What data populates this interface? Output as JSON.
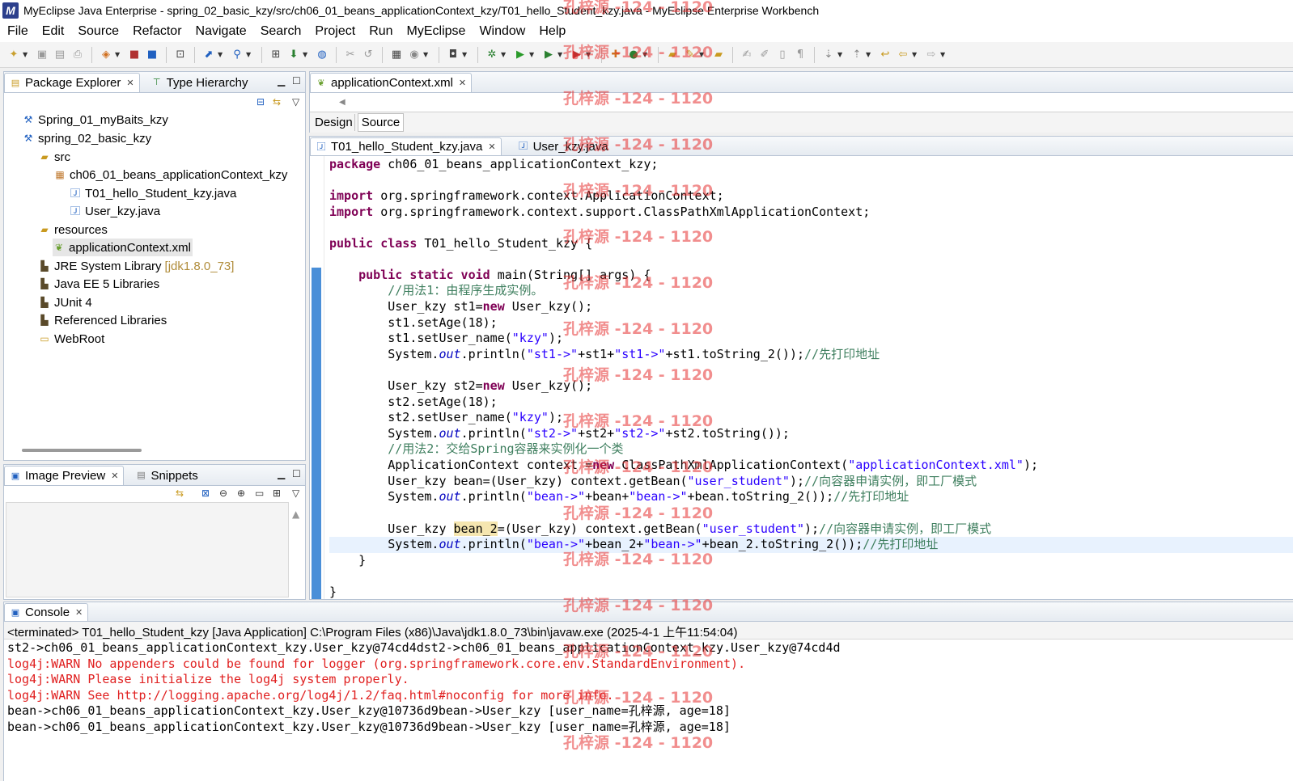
{
  "window": {
    "title": "MyEclipse Java Enterprise - spring_02_basic_kzy/src/ch06_01_beans_applicationContext_kzy/T01_hello_Student_kzy.java - MyEclipse Enterprise Workbench"
  },
  "menu": [
    "File",
    "Edit",
    "Source",
    "Refactor",
    "Navigate",
    "Search",
    "Project",
    "Run",
    "MyEclipse",
    "Window",
    "Help"
  ],
  "package_explorer": {
    "tabs": [
      "Package Explorer",
      "Type Hierarchy"
    ],
    "tree": [
      {
        "label": "Spring_01_myBaits_kzy",
        "icon": "project-icon"
      },
      {
        "label": "spring_02_basic_kzy",
        "icon": "project-icon"
      },
      {
        "label": "src",
        "icon": "source-folder-icon"
      },
      {
        "label": "ch06_01_beans_applicationContext_kzy",
        "icon": "package-icon"
      },
      {
        "label": "T01_hello_Student_kzy.java",
        "icon": "java-file-icon"
      },
      {
        "label": "User_kzy.java",
        "icon": "java-file-icon"
      },
      {
        "label": "resources",
        "icon": "source-folder-icon"
      },
      {
        "label": "applicationContext.xml",
        "icon": "xml-file-icon"
      },
      {
        "label": "JRE System Library",
        "decoration": "[jdk1.8.0_73]",
        "icon": "library-icon"
      },
      {
        "label": "Java EE 5 Libraries",
        "icon": "library-icon"
      },
      {
        "label": "JUnit 4",
        "icon": "library-icon"
      },
      {
        "label": "Referenced Libraries",
        "icon": "library-icon"
      },
      {
        "label": "WebRoot",
        "icon": "folder-icon"
      }
    ]
  },
  "image_preview": {
    "tabs": [
      "Image Preview",
      "Snippets"
    ]
  },
  "xml_editor": {
    "tab": "applicationContext.xml",
    "subtabs": [
      "Design",
      "Source"
    ]
  },
  "java_editor": {
    "tabs": [
      "T01_hello_Student_kzy.java",
      "User_kzy.java"
    ],
    "code": {
      "l1a": "package",
      "l1b": " ch06_01_beans_applicationContext_kzy;",
      "l3a": "import",
      "l3b": " org.springframework.context.ApplicationContext;",
      "l4a": "import",
      "l4b": " org.springframework.context.support.ClassPathXmlApplicationContext;",
      "l6a": "public class",
      "l6b": " T01_hello_Student_kzy {",
      "l8pre": "    ",
      "l8a": "public static void",
      "l8b": " main(String[] args) {",
      "l9": "        //用法1：由程序生成实例。",
      "l10a": "        User_kzy st1=",
      "l10b": "new",
      "l10c": " User_kzy();",
      "l11": "        st1.setAge(18);",
      "l12a": "        st1.setUser_name(",
      "l12b": "\"kzy\"",
      "l12c": ");",
      "l13a": "        System.",
      "l13b": "out",
      "l13c": ".println(",
      "l13d": "\"st1->\"",
      "l13e": "+st1+",
      "l13f": "\"st1->\"",
      "l13g": "+st1.toString_2());",
      "l13h": "//先打印地址",
      "l15a": "        User_kzy st2=",
      "l15b": "new",
      "l15c": " User_kzy();",
      "l16": "        st2.setAge(18);",
      "l17a": "        st2.setUser_name(",
      "l17b": "\"kzy\"",
      "l17c": ");",
      "l18a": "        System.",
      "l18b": "out",
      "l18c": ".println(",
      "l18d": "\"st2->\"",
      "l18e": "+st2+",
      "l18f": "\"st2->\"",
      "l18g": "+st2.toString());",
      "l19": "        //用法2：交给Spring容器来实例化一个类",
      "l20a": "        ApplicationContext context =",
      "l20b": "new",
      "l20c": " ClassPathXmlApplicationContext(",
      "l20d": "\"applicationContext.xml\"",
      "l20e": ");",
      "l21a": "        User_kzy bean=(User_kzy) context.getBean(",
      "l21b": "\"user_student\"",
      "l21c": ");",
      "l21d": "//向容器申请实例，即工厂模式",
      "l22a": "        System.",
      "l22b": "out",
      "l22c": ".println(",
      "l22d": "\"bean->\"",
      "l22e": "+bean+",
      "l22f": "\"bean->\"",
      "l22g": "+bean.toString_2());",
      "l22h": "//先打印地址",
      "l24a": "        User_kzy ",
      "l24b": "bean_2",
      "l24c": "=(User_kzy) context.getBean(",
      "l24d": "\"user_student\"",
      "l24e": ");",
      "l24f": "//向容器申请实例，即工厂模式",
      "l25a": "        System.",
      "l25b": "out",
      "l25c": ".println(",
      "l25d": "\"bean->\"",
      "l25e": "+bean_2+",
      "l25f": "\"bean->\"",
      "l25g": "+bean_2.toString_2());",
      "l25h": "//先打印地址",
      "l26": "    }",
      "l28": "}"
    }
  },
  "console": {
    "tab": "Console",
    "header": "<terminated> T01_hello_Student_kzy [Java Application] C:\\Program Files (x86)\\Java\\jdk1.8.0_73\\bin\\javaw.exe (2025-4-1 上午11:54:04)",
    "lines": [
      "st2->ch06_01_beans_applicationContext_kzy.User_kzy@74cd4dst2->ch06_01_beans_applicationContext_kzy.User_kzy@74cd4d",
      "log4j:WARN No appenders could be found for logger (org.springframework.core.env.StandardEnvironment).",
      "log4j:WARN Please initialize the log4j system properly.",
      "log4j:WARN See http://logging.apache.org/log4j/1.2/faq.html#noconfig for more info.",
      "bean->ch06_01_beans_applicationContext_kzy.User_kzy@10736d9bean->User_kzy [user_name=孔梓源, age=18]",
      "bean->ch06_01_beans_applicationContext_kzy.User_kzy@10736d9bean->User_kzy [user_name=孔梓源, age=18]"
    ]
  },
  "watermark": "孔梓源 -124 - 1120",
  "colors": {
    "keyword": "#7f0055",
    "string": "#2a00ff",
    "comment": "#3f7f5f",
    "error": "#e02020",
    "watermark": "#e63232"
  }
}
